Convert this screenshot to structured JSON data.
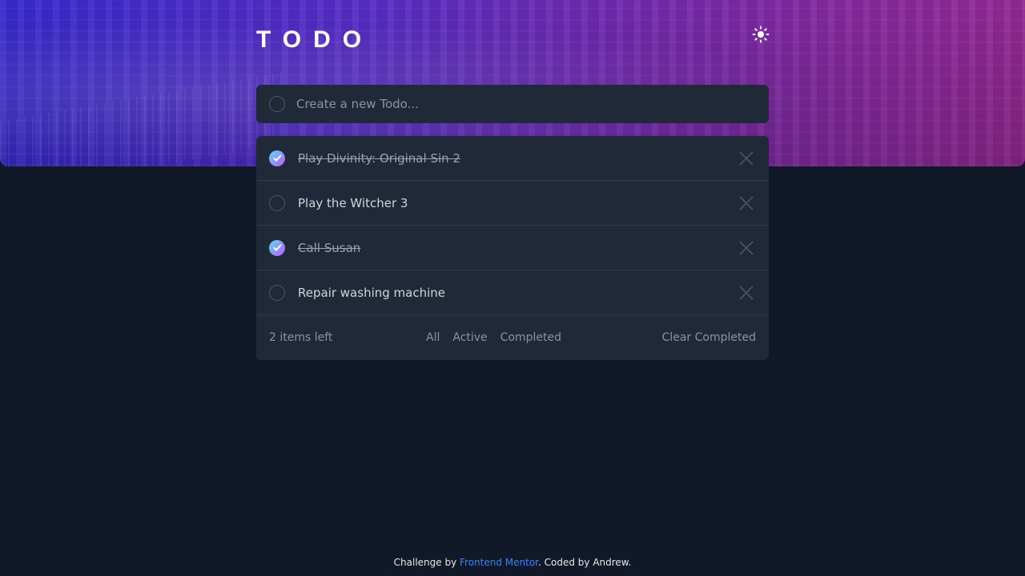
{
  "app": {
    "title": "TODO"
  },
  "theme_toggle": {
    "icon": "sun-icon"
  },
  "new_todo": {
    "placeholder": "Create a new Todo..."
  },
  "todos": [
    {
      "text": "Play Divinity: Original Sin 2",
      "completed": true
    },
    {
      "text": "Play the Witcher 3",
      "completed": false
    },
    {
      "text": "Call Susan",
      "completed": true
    },
    {
      "text": "Repair washing machine",
      "completed": false
    }
  ],
  "footer_bar": {
    "items_left": "2 items left",
    "filters": [
      "All",
      "Active",
      "Completed"
    ],
    "clear_label": "Clear Completed"
  },
  "page_footer": {
    "prefix": "Challenge by ",
    "link_text": "Frontend Mentor",
    "suffix": ". Coded by Andrew."
  },
  "colors": {
    "background": "#111827",
    "card": "#1f2937",
    "check_gradient_start": "#57ddff",
    "check_gradient_end": "#c058f3",
    "link": "#3b82f6"
  }
}
